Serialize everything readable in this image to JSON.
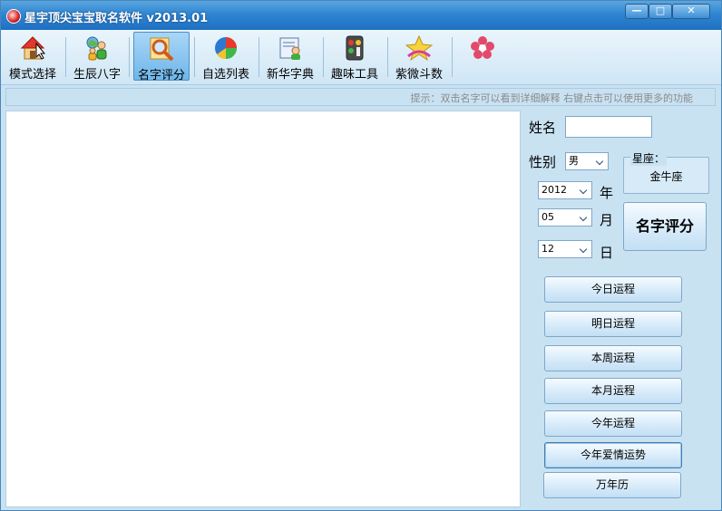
{
  "window": {
    "title": "星宇顶尖宝宝取名软件 v2013.01",
    "controls": {
      "minimize": "—",
      "maximize": "□",
      "close": "✕"
    }
  },
  "toolbar": {
    "items": [
      {
        "label": "模式选择",
        "icon": "house-icon"
      },
      {
        "label": "生辰八字",
        "icon": "people-icon"
      },
      {
        "label": "名字评分",
        "icon": "magnifier-icon",
        "active": true
      },
      {
        "label": "自选列表",
        "icon": "pie-chart-icon"
      },
      {
        "label": "新华字典",
        "icon": "dictionary-icon"
      },
      {
        "label": "趣味工具",
        "icon": "tools-icon"
      },
      {
        "label": "紫微斗数",
        "icon": "star-icon"
      },
      {
        "label": "",
        "icon": "flower-icon"
      }
    ]
  },
  "hint": "提示：双击名字可以看到详细解释    右键点击可以使用更多的功能",
  "form": {
    "name_label": "姓名",
    "name_value": "",
    "gender_label": "性别",
    "gender_value": "男",
    "zodiac_title": "星座：",
    "zodiac_value": "金牛座",
    "year_value": "2012",
    "year_label": "年",
    "month_value": "05",
    "month_label": "月",
    "day_value": "12",
    "day_label": "日",
    "score_button": "名字评分"
  },
  "fortune_buttons": [
    "今日运程",
    "明日运程",
    "本周运程",
    "本月运程",
    "今年运程",
    "今年爱情运势",
    "万年历"
  ],
  "colors": {
    "titlebar": "#2f86d3",
    "panel": "#c9e2f2",
    "accent": "#6fb6ea"
  }
}
